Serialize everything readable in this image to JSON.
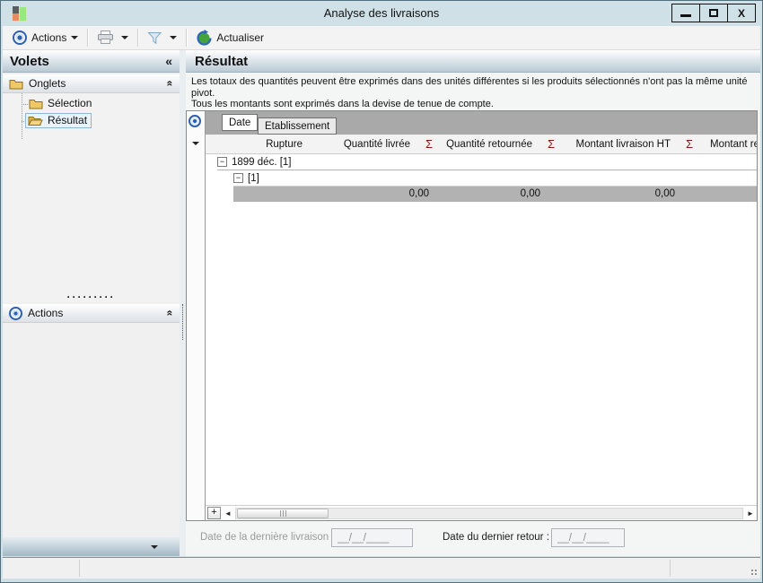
{
  "window": {
    "title": "Analyse des livraisons",
    "close_glyph": "X"
  },
  "toolbar": {
    "actions_label": "Actions",
    "refresh_label": "Actualiser"
  },
  "sidebar": {
    "title": "Volets",
    "collapse_glyph": "«",
    "onglets_label": "Onglets",
    "items": [
      {
        "label": "Sélection"
      },
      {
        "label": "Résultat"
      }
    ],
    "actions_label": "Actions",
    "drag_dots": "·········"
  },
  "glyphs": {
    "chevron_up": "«",
    "expander_minus": "−",
    "add": "+",
    "scroll_left": "◄",
    "scroll_right": "►"
  },
  "main": {
    "title": "Résultat",
    "desc1": "Les totaux des quantités peuvent être exprimés dans des unités différentes si les produits sélectionnés n'ont pas la même unité pivot.",
    "desc2": "Tous les montants sont exprimés dans la devise de tenue de compte.",
    "grid": {
      "tabs": [
        {
          "label": "Date"
        },
        {
          "label": "Etablissement"
        }
      ],
      "columns": {
        "rupture": "Rupture",
        "qty_delivered": "Quantité livrée",
        "sigma": "Σ",
        "qty_returned": "Quantité retournée",
        "amount_delivery_ht": "Montant livraison HT",
        "amount_return_cut": "Montant re"
      },
      "group_row_1": "1899 déc. [1]",
      "group_row_2": "[1]",
      "summary": {
        "v1": "0,00",
        "v2": "0,00",
        "v3": "0,00"
      }
    },
    "footer": {
      "label_last_delivery": "Date de la dernière livraison :",
      "value_last_delivery": "__/__/____",
      "label_last_return": "Date du dernier retour :",
      "value_last_return": "__/__/____"
    }
  },
  "colors": {
    "sigma_red": "#8e1616",
    "selection_blue": "#92b6d5",
    "action_blue": "#2f5fb0",
    "refresh_green": "#45a33c",
    "folder_tan": "#efc868"
  }
}
